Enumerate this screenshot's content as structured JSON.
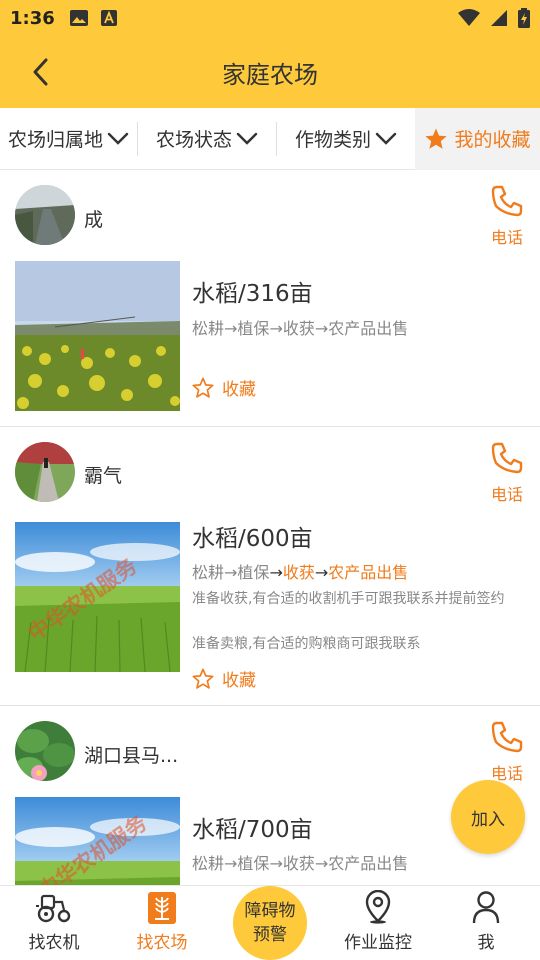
{
  "status_bar": {
    "time": "1:36"
  },
  "header": {
    "title": "家庭农场"
  },
  "filters": [
    {
      "label": "农场归属地"
    },
    {
      "label": "农场状态"
    },
    {
      "label": "作物类别"
    },
    {
      "label": "我的收藏"
    }
  ],
  "farms": [
    {
      "owner": "成",
      "phone_label": "电话",
      "crop": "水稻/316亩",
      "process": {
        "s1": "松耕",
        "s2": "植保",
        "s3": "收获",
        "s4": "农产品出售"
      },
      "fav_label": "收藏"
    },
    {
      "owner": "霸气",
      "phone_label": "电话",
      "crop": "水稻/600亩",
      "process": {
        "s1": "松耕",
        "s2": "植保",
        "s3": "收获",
        "s4": "农产品出售"
      },
      "notes": [
        "准备收获,有合适的收割机手可跟我联系并提前签约",
        "准备卖粮,有合适的购粮商可跟我联系"
      ],
      "watermark": "中华农机服务",
      "fav_label": "收藏"
    },
    {
      "owner": "湖口县马...",
      "phone_label": "电话",
      "crop": "水稻/700亩",
      "process": {
        "s1": "松耕",
        "s2": "植保",
        "s3": "收获",
        "s4": "农产品出售"
      },
      "watermark": "中华农机服务"
    }
  ],
  "join_button": {
    "label": "加入"
  },
  "tabs": [
    {
      "label": "找农机"
    },
    {
      "label": "找农场"
    },
    {
      "label": "障碍物预警",
      "line1": "障碍物",
      "line2": "预警"
    },
    {
      "label": "作业监控"
    },
    {
      "label": "我"
    }
  ],
  "colors": {
    "accent": "#fec93a",
    "highlight": "#f07c1c"
  }
}
